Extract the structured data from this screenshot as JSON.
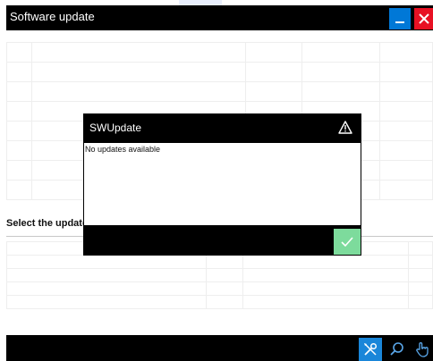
{
  "window": {
    "title": "Software update"
  },
  "section": {
    "label": "Select the update"
  },
  "dialog": {
    "title": "SWUpdate",
    "message": "No updates available",
    "icon": "warning-icon"
  },
  "taskbar": {
    "icons": [
      "tools-icon",
      "search-icon",
      "hand-pointer-icon"
    ]
  },
  "colors": {
    "titlebar": "#000000",
    "minimize_button": "#0078d7",
    "close_button": "#e81123",
    "confirm_button": "#7ddb9c",
    "taskbar_active": "#1a86d9"
  }
}
